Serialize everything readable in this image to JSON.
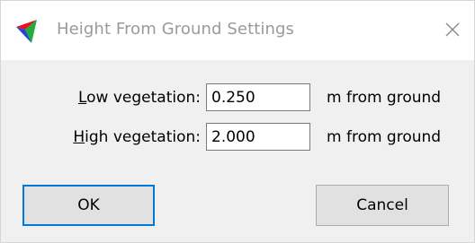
{
  "window": {
    "title": "Height From Ground Settings",
    "close_icon": "close-icon",
    "app_icon": "tri-color-arrow-icon"
  },
  "form": {
    "low_label_mnemonic": "L",
    "low_label_rest": "ow vegetation:",
    "low_value": "0.250",
    "low_unit": "m from ground",
    "high_label_mnemonic": "H",
    "high_label_rest": "igh vegetation:",
    "high_value": "2.000",
    "high_unit": "m from ground"
  },
  "buttons": {
    "ok_label": "OK",
    "cancel_label": "Cancel"
  },
  "colors": {
    "title_text": "#9a9a9a",
    "panel_bg": "#f0f0f0",
    "button_bg": "#e1e1e1",
    "focus_border": "#0078d7",
    "icon_red": "#e8141c",
    "icon_green": "#1fae3a",
    "icon_blue": "#2345d6"
  }
}
